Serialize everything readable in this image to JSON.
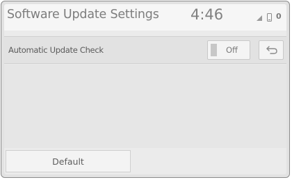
{
  "header": {
    "title": "Software Update Settings",
    "clock": "4:46",
    "message_count": "0",
    "icons": [
      "signal-icon",
      "phone-icon"
    ]
  },
  "settings": {
    "automatic_update_check": {
      "label": "Automatic Update Check",
      "value": "Off"
    }
  },
  "back_button": {
    "icon": "back-arrow-icon"
  },
  "footer": {
    "default_label": "Default"
  },
  "colors": {
    "background": "#ebebeb",
    "header_background": "#f6f6f6",
    "text": "#7d7d7d",
    "button_background": "#f4f4f4"
  }
}
